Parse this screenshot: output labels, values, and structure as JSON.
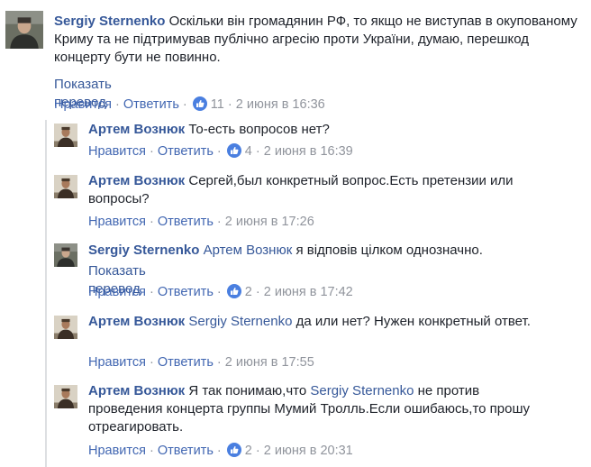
{
  "top_comment": {
    "author": "Sergiy Sternenko",
    "text": "Оскільки він громадянин РФ, то якщо не виступав в окупованому Криму та не підтримував публічно агресію проти України, думаю, перешкод концерту бути не повинно.",
    "translate": "Показать перевод",
    "like": "Нравится",
    "reply": "Ответить",
    "likes": "11",
    "time": "2 июня в 16:36"
  },
  "replies": [
    {
      "author": "Артем Вознюк",
      "text": "То-есть вопросов нет?",
      "like": "Нравится",
      "reply": "Ответить",
      "likes": "4",
      "time": "2 июня в 16:39"
    },
    {
      "author": "Артем Вознюк",
      "text": "Сергей,был конкретный вопрос.Есть претензии или вопросы?",
      "like": "Нравится",
      "reply": "Ответить",
      "time": "2 июня в 17:26"
    },
    {
      "author": "Sergiy Sternenko",
      "mention": "Артем Вознюк",
      "text": "я відповів цілком однозначно.",
      "translate": "Показать перевод",
      "like": "Нравится",
      "reply": "Ответить",
      "likes": "2",
      "time": "2 июня в 17:42"
    },
    {
      "author": "Артем Вознюк",
      "mention": "Sergiy Sternenko",
      "text": "да или нет? Нужен конкретный ответ.",
      "like": "Нравится",
      "reply": "Ответить",
      "time": "2 июня в 17:55"
    },
    {
      "author": "Артем Вознюк",
      "text_before": "Я так понимаю,что",
      "mention": "Sergiy Sternenko",
      "text": "не против проведения концерта группы Мумий Тролль.Если ошибаюсь,то прошу отреагировать.",
      "like": "Нравится",
      "reply": "Ответить",
      "likes": "2",
      "time": "2 июня в 20:31"
    }
  ],
  "separator": "·",
  "colors": {
    "link": "#365899",
    "action": "#4267b2",
    "meta": "#90949c",
    "like_badge": "#4a7fe0"
  }
}
